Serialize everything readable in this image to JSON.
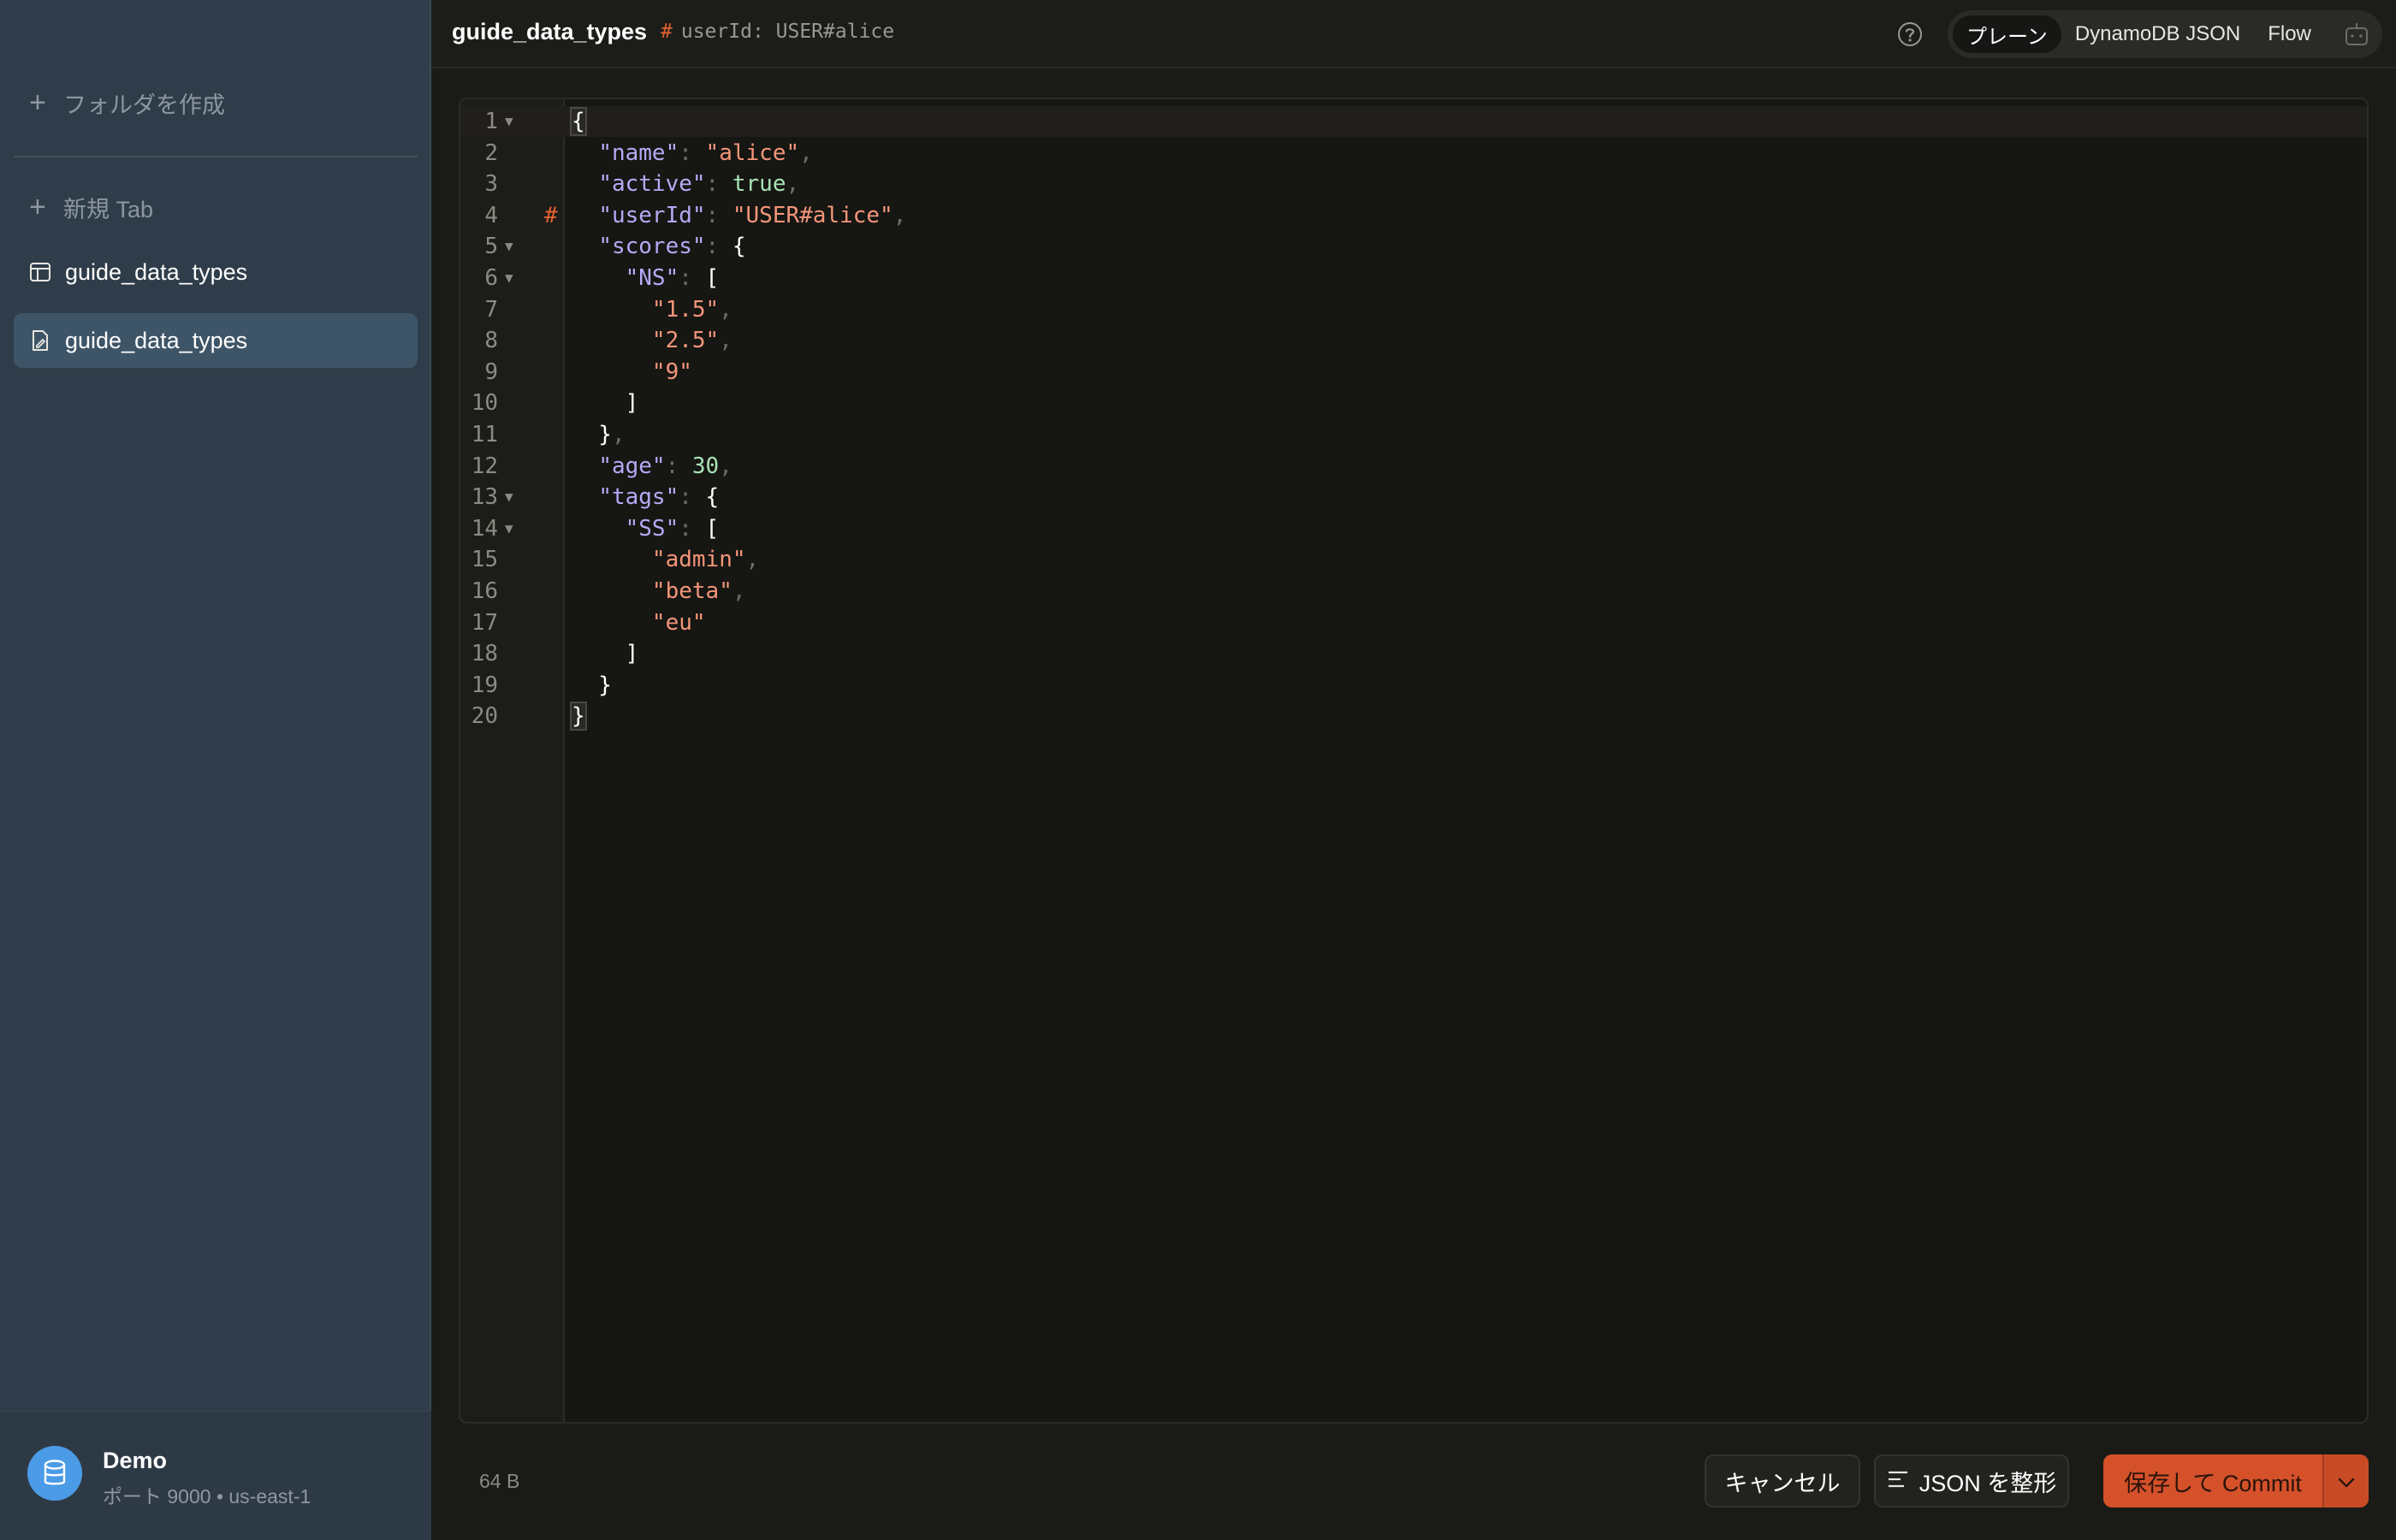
{
  "sidebar": {
    "create_folder": "フォルダを作成",
    "new_tab": "新規 Tab",
    "items": [
      {
        "label": "guide_data_types",
        "icon": "table-icon"
      },
      {
        "label": "guide_data_types",
        "icon": "document-edit-icon",
        "active": true
      }
    ],
    "connection": {
      "name": "Demo",
      "detail": "ポート 9000 • us-east-1",
      "icon": "database-icon"
    }
  },
  "header": {
    "title": "guide_data_types",
    "key_hash": "#",
    "key_label": "userId: USER#alice",
    "modes": [
      "プレーン",
      "DynamoDB JSON",
      "Flow"
    ],
    "active_mode": "プレーン"
  },
  "editor": {
    "lines": [
      "{",
      "  \"name\": \"alice\",",
      "  \"active\": true,",
      "  \"userId\": \"USER#alice\",",
      "  \"scores\": {",
      "    \"NS\": [",
      "      \"1.5\",",
      "      \"2.5\",",
      "      \"9\"",
      "    ]",
      "  },",
      "  \"age\": 30,",
      "  \"tags\": {",
      "    \"SS\": [",
      "      \"admin\",",
      "      \"beta\",",
      "      \"eu\"",
      "    ]",
      "  }",
      "}"
    ],
    "fold_lines": [
      1,
      5,
      6,
      13,
      14
    ],
    "key_marker_line": 4,
    "key_marker": "#"
  },
  "footer": {
    "size": "64 B",
    "cancel": "キャンセル",
    "format": "JSON を整形",
    "commit": "保存して Commit"
  },
  "colors": {
    "accent": "#d4512a",
    "key": "#b7a9f5",
    "string": "#f49679",
    "literal": "#a8e3b5"
  }
}
